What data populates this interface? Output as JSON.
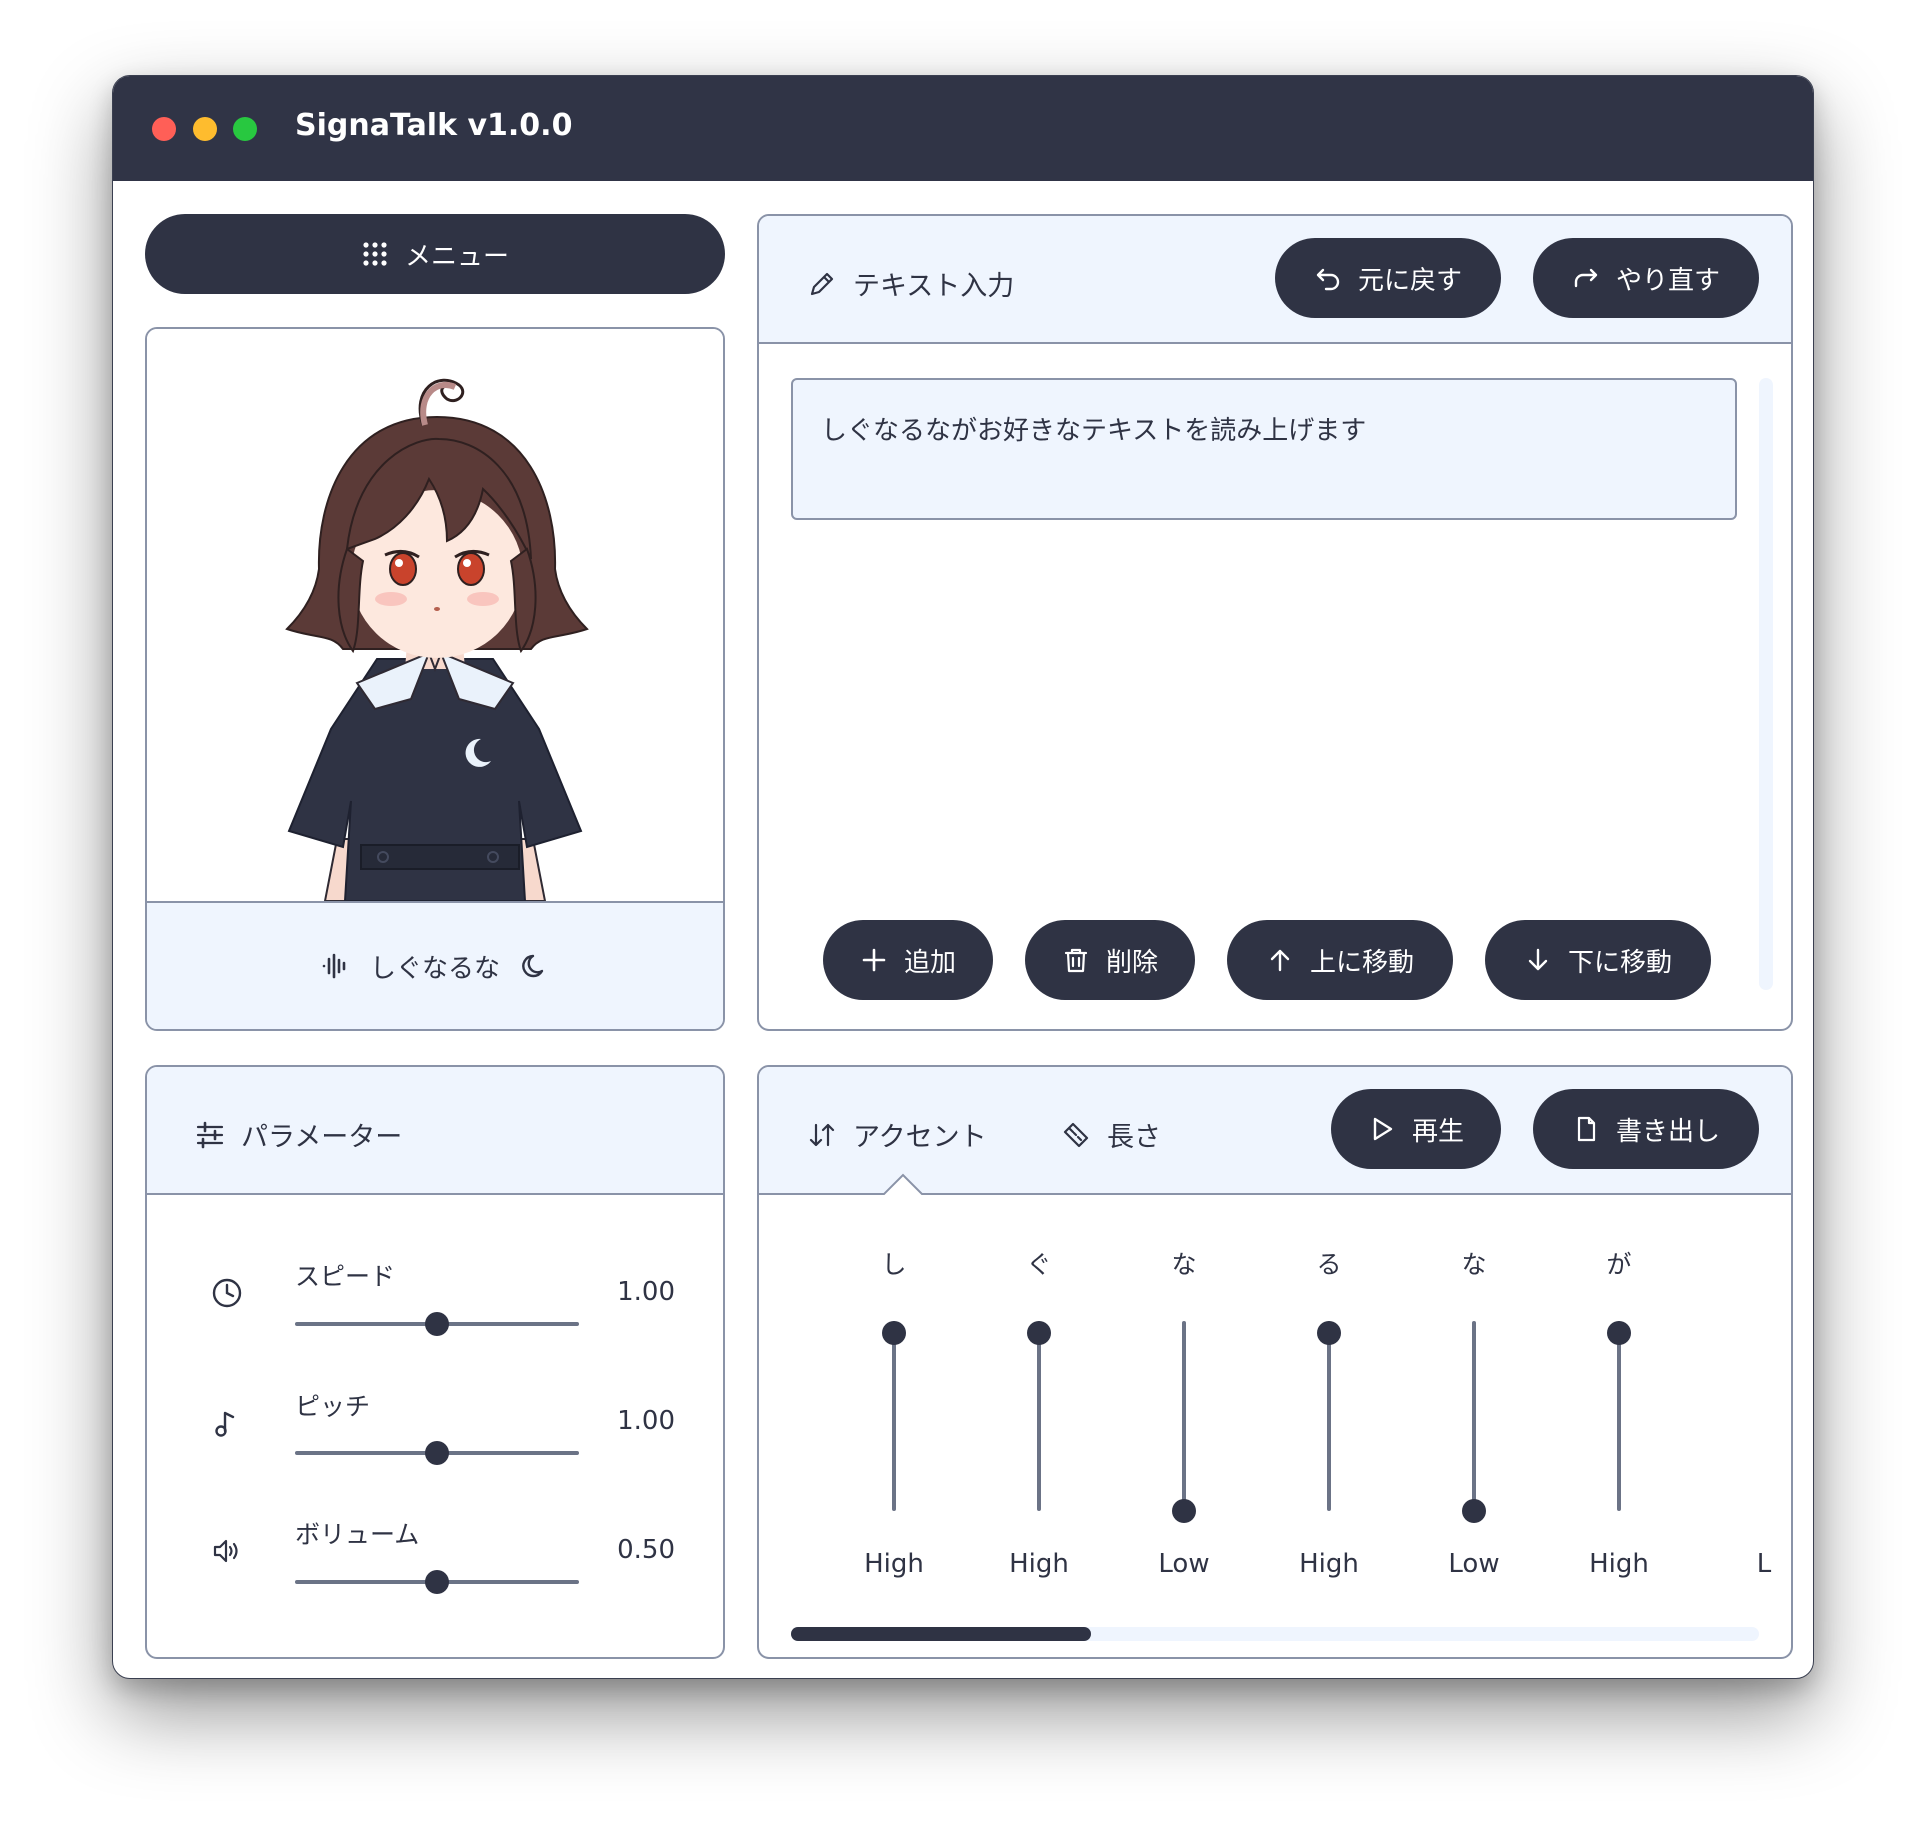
{
  "window": {
    "title": "SignaTalk v1.0.0"
  },
  "menu": {
    "label": "メニュー",
    "icon": "grid-icon"
  },
  "character": {
    "name": "しぐなるな",
    "voice_icon": "waveform-icon",
    "mode_icon": "moon-icon"
  },
  "text_input": {
    "header": "テキスト入力",
    "undo_label": "元に戻す",
    "redo_label": "やり直す",
    "text": "しぐなるながお好きなテキストを読み上げます",
    "add_label": "追加",
    "delete_label": "削除",
    "move_up_label": "上に移動",
    "move_down_label": "下に移動"
  },
  "parameters": {
    "header": "パラメーター",
    "items": [
      {
        "label": "スピード",
        "value": "1.00",
        "level": 0.5,
        "icon": "clock-icon"
      },
      {
        "label": "ピッチ",
        "value": "1.00",
        "level": 0.5,
        "icon": "music-note-icon"
      },
      {
        "label": "ボリューム",
        "value": "0.50",
        "level": 0.5,
        "icon": "speaker-icon"
      }
    ]
  },
  "accent": {
    "tab_accent": "アクセント",
    "tab_length": "長さ",
    "play_label": "再生",
    "export_label": "書き出し",
    "morae": [
      {
        "char": "し",
        "level": "High"
      },
      {
        "char": "ぐ",
        "level": "High"
      },
      {
        "char": "な",
        "level": "Low"
      },
      {
        "char": "る",
        "level": "High"
      },
      {
        "char": "な",
        "level": "Low"
      },
      {
        "char": "が",
        "level": "High"
      },
      {
        "char": "",
        "level": "L"
      }
    ],
    "scroll_fraction": 0.31
  },
  "colors": {
    "dark": "#2f3344",
    "light_bg": "#eff5fe",
    "border": "#8a93a8"
  }
}
